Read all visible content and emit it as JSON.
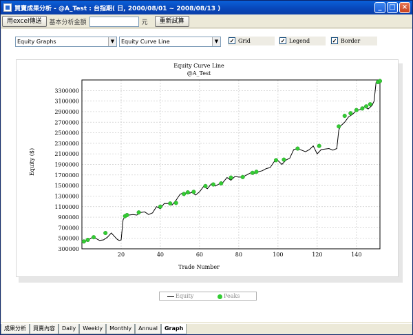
{
  "window": {
    "title": "買賣成果分析 - @A_Test : 台指期( 日, 2000/08/01 ~ 2008/08/13 )",
    "minimize": "_",
    "maximize": "□",
    "close": "×"
  },
  "toolbar": {
    "export_label": "用excel傳送",
    "capital_label": "基本分析金額",
    "capital_value": "",
    "unit_label": "元",
    "recalc_label": "重新試算"
  },
  "controls": {
    "graph_select": "Equity Graphs",
    "curve_select": "Equity Curve Line",
    "grid_label": "Grid",
    "legend_label": "Legend",
    "border_label": "Border",
    "grid_checked": true,
    "legend_checked": true,
    "border_checked": true
  },
  "chart_data": {
    "type": "line",
    "title": "Equity Curve Line",
    "subtitle": "@A_Test",
    "xlabel": "Trade Number",
    "ylabel": "Equity ($)",
    "xlim": [
      0,
      152
    ],
    "ylim": [
      300000,
      3500000
    ],
    "xticks": [
      20,
      40,
      60,
      80,
      100,
      120,
      140
    ],
    "yticks": [
      300000,
      500000,
      700000,
      900000,
      1100000,
      1300000,
      1500000,
      1700000,
      1900000,
      2100000,
      2300000,
      2500000,
      2700000,
      2900000,
      3100000,
      3300000
    ],
    "grid": true,
    "legend_position": "bottom",
    "series": [
      {
        "name": "Equity",
        "color": "#000000",
        "x": [
          1,
          3,
          5,
          7,
          9,
          11,
          13,
          15,
          17,
          18,
          19,
          20,
          21,
          22,
          24,
          26,
          28,
          30,
          32,
          34,
          36,
          38,
          40,
          42,
          44,
          46,
          48,
          50,
          52,
          54,
          56,
          58,
          60,
          62,
          64,
          66,
          68,
          70,
          72,
          74,
          76,
          78,
          80,
          82,
          84,
          86,
          88,
          90,
          92,
          94,
          96,
          98,
          100,
          102,
          104,
          106,
          108,
          110,
          112,
          114,
          116,
          118,
          120,
          122,
          124,
          126,
          128,
          130,
          131,
          132,
          134,
          136,
          138,
          140,
          142,
          144,
          146,
          148,
          149,
          150,
          152
        ],
        "y": [
          430000,
          460000,
          510000,
          500000,
          460000,
          470000,
          520000,
          600000,
          520000,
          480000,
          460000,
          470000,
          850000,
          920000,
          940000,
          950000,
          940000,
          990000,
          1000000,
          950000,
          980000,
          1100000,
          1060000,
          1160000,
          1160000,
          1130000,
          1220000,
          1330000,
          1370000,
          1340000,
          1370000,
          1320000,
          1380000,
          1480000,
          1440000,
          1530000,
          1490000,
          1530000,
          1560000,
          1650000,
          1600000,
          1670000,
          1660000,
          1660000,
          1700000,
          1740000,
          1730000,
          1760000,
          1780000,
          1820000,
          1840000,
          1950000,
          1970000,
          1900000,
          1980000,
          2020000,
          2180000,
          2200000,
          2170000,
          2140000,
          2180000,
          2250000,
          2100000,
          2180000,
          2190000,
          2200000,
          2170000,
          2200000,
          2550000,
          2630000,
          2700000,
          2800000,
          2850000,
          2920000,
          2940000,
          2990000,
          2950000,
          3020000,
          3100000,
          3450000,
          3470000
        ]
      },
      {
        "name": "Peaks",
        "color": "#33cc33",
        "x": [
          1,
          3,
          6,
          12,
          22,
          23,
          29,
          40,
          45,
          48,
          52,
          54,
          57,
          63,
          67,
          71,
          76,
          82,
          87,
          89,
          99,
          103,
          110,
          121,
          131,
          134,
          137,
          140,
          143,
          145,
          147,
          151,
          152
        ],
        "y": [
          440000,
          470000,
          520000,
          600000,
          920000,
          940000,
          990000,
          1100000,
          1160000,
          1170000,
          1340000,
          1370000,
          1380000,
          1490000,
          1520000,
          1540000,
          1650000,
          1660000,
          1740000,
          1760000,
          1980000,
          1990000,
          2200000,
          2250000,
          2620000,
          2820000,
          2870000,
          2930000,
          2960000,
          3000000,
          3040000,
          3460000,
          3480000
        ]
      }
    ]
  },
  "tabs": [
    "成果分析",
    "買賣內容",
    "Daily",
    "Weekly",
    "Monthly",
    "Annual",
    "Graph"
  ],
  "active_tab": "Graph"
}
